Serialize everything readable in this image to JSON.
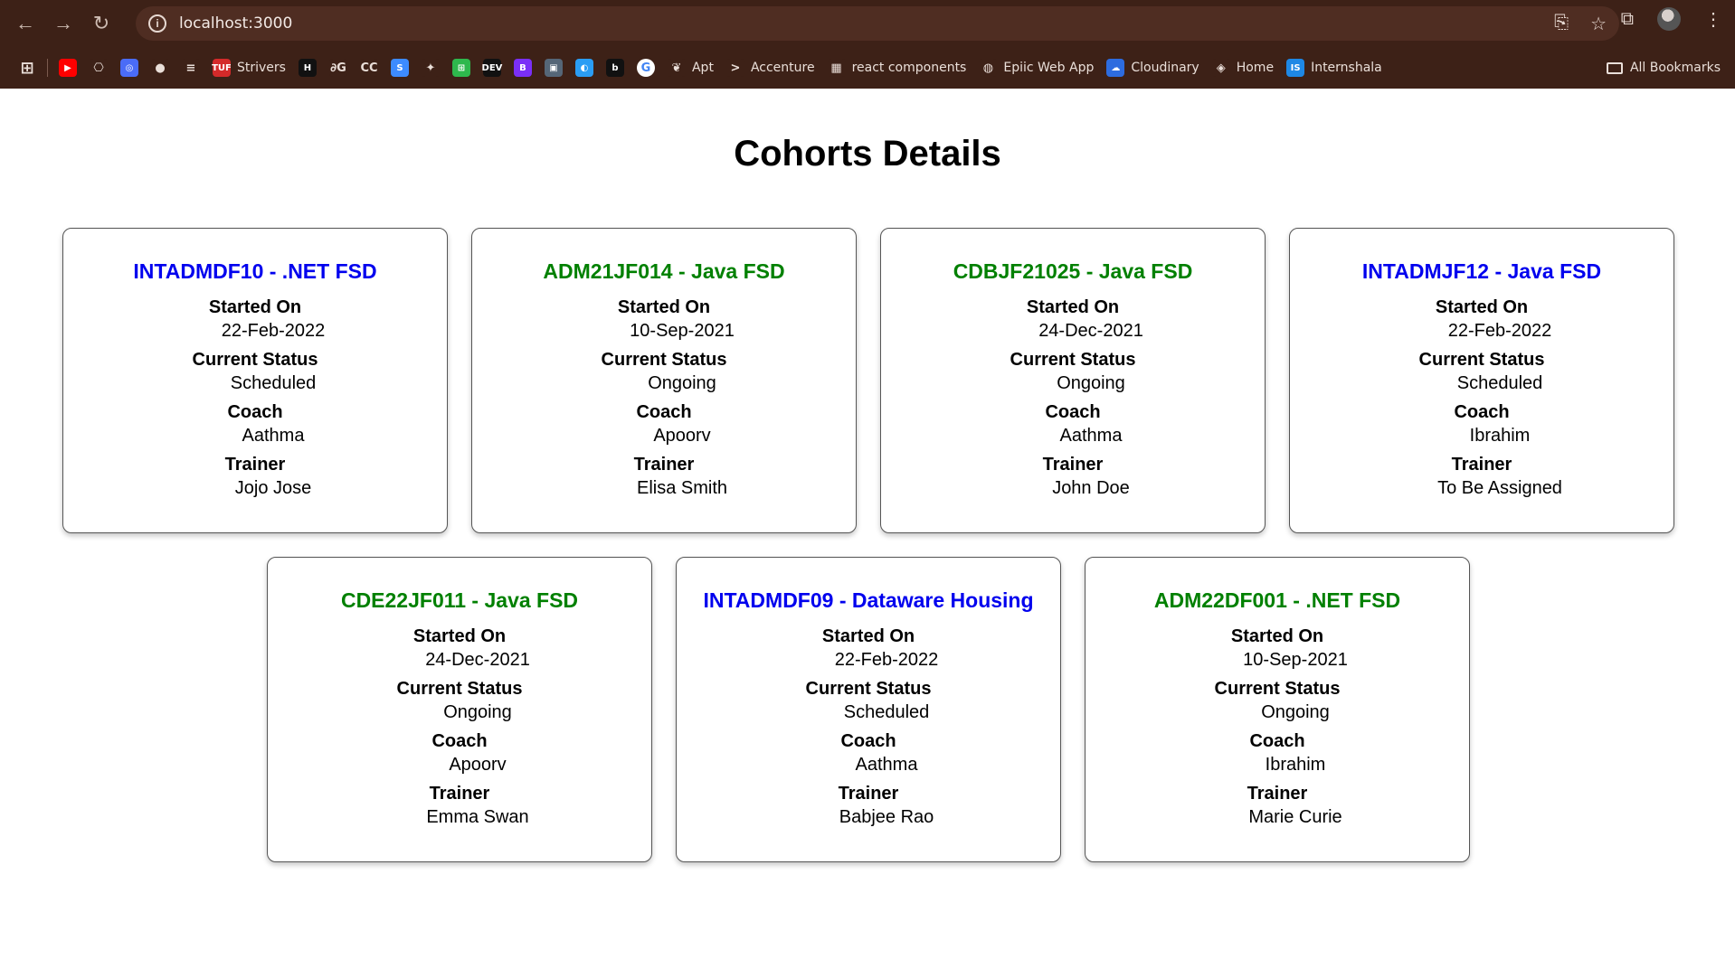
{
  "browser": {
    "url": "localhost:3000",
    "bookmarks": [
      {
        "label": "",
        "icon": "youtube-icon",
        "color": "#ff0000",
        "glyph": "▶"
      },
      {
        "label": "",
        "icon": "openai-icon",
        "color": "#3d2117",
        "glyph": "⎔"
      },
      {
        "label": "",
        "icon": "codeium-icon",
        "color": "#4a6cf7",
        "glyph": "◎"
      },
      {
        "label": "",
        "icon": "github-icon",
        "color": "#3d2117",
        "glyph": "●"
      },
      {
        "label": "",
        "icon": "stackoverflow-icon",
        "color": "#3d2117",
        "glyph": "≡"
      },
      {
        "label": "Strivers",
        "icon": "tuf-icon",
        "color": "#d42a2a",
        "glyph": "TUF"
      },
      {
        "label": "",
        "icon": "hackerrank-icon",
        "color": "#111111",
        "glyph": "H"
      },
      {
        "label": "",
        "icon": "geeksforgeeks-icon",
        "color": "#3d2117",
        "glyph": "∂G"
      },
      {
        "label": "",
        "icon": "codechef-icon",
        "color": "#3d2117",
        "glyph": "CC"
      },
      {
        "label": "",
        "icon": "swiggy-icon",
        "color": "#3d8bff",
        "glyph": "S"
      },
      {
        "label": "",
        "icon": "figma-icon",
        "color": "#3d2117",
        "glyph": "✦"
      },
      {
        "label": "",
        "icon": "green-app-icon",
        "color": "#2eb84d",
        "glyph": "⊞"
      },
      {
        "label": "",
        "icon": "dev-icon",
        "color": "#111111",
        "glyph": "DEV"
      },
      {
        "label": "",
        "icon": "bootstrap-icon",
        "color": "#7a2ff7",
        "glyph": "B"
      },
      {
        "label": "",
        "icon": "image-icon",
        "color": "#556677",
        "glyph": "▣"
      },
      {
        "label": "",
        "icon": "edge-icon",
        "color": "#2a9df4",
        "glyph": "◐"
      },
      {
        "label": "",
        "icon": "b-black-icon",
        "color": "#111111",
        "glyph": "b"
      },
      {
        "label": "",
        "icon": "google-icon",
        "color": "#ffffff",
        "glyph": "G"
      },
      {
        "label": "Apt",
        "icon": "apt-icon",
        "color": "#3d2117",
        "glyph": "❦"
      },
      {
        "label": "Accenture",
        "icon": "accenture-icon",
        "color": "#3d2117",
        "glyph": ">"
      },
      {
        "label": "react components",
        "icon": "react-components-icon",
        "color": "#3d2117",
        "glyph": "▦"
      },
      {
        "label": "Epiic Web App",
        "icon": "epiic-icon",
        "color": "#3d2117",
        "glyph": "◍"
      },
      {
        "label": "Cloudinary",
        "icon": "cloudinary-icon",
        "color": "#2d6cdf",
        "glyph": "☁"
      },
      {
        "label": "Home",
        "icon": "home-icon",
        "color": "#3d2117",
        "glyph": "◈"
      },
      {
        "label": "Internshala",
        "icon": "internshala-icon",
        "color": "#1e88e5",
        "glyph": "IS"
      }
    ],
    "all_bookmarks_label": "All Bookmarks"
  },
  "page": {
    "title": "Cohorts Details",
    "labels": {
      "started_on": "Started On",
      "current_status": "Current Status",
      "coach": "Coach",
      "trainer": "Trainer"
    },
    "colors": {
      "scheduled": "#0000ee",
      "ongoing": "#008000"
    },
    "cohorts": [
      {
        "code": "INTADMDF10 - .NET FSD",
        "started_on": "22-Feb-2022",
        "status": "Scheduled",
        "coach": "Aathma",
        "trainer": "Jojo Jose",
        "title_color": "#0000ee"
      },
      {
        "code": "ADM21JF014 - Java FSD",
        "started_on": "10-Sep-2021",
        "status": "Ongoing",
        "coach": "Apoorv",
        "trainer": "Elisa Smith",
        "title_color": "#008000"
      },
      {
        "code": "CDBJF21025 - Java FSD",
        "started_on": "24-Dec-2021",
        "status": "Ongoing",
        "coach": "Aathma",
        "trainer": "John Doe",
        "title_color": "#008000"
      },
      {
        "code": "INTADMJF12 - Java FSD",
        "started_on": "22-Feb-2022",
        "status": "Scheduled",
        "coach": "Ibrahim",
        "trainer": "To Be Assigned",
        "title_color": "#0000ee"
      },
      {
        "code": "CDE22JF011 - Java FSD",
        "started_on": "24-Dec-2021",
        "status": "Ongoing",
        "coach": "Apoorv",
        "trainer": "Emma Swan",
        "title_color": "#008000"
      },
      {
        "code": "INTADMDF09 - Dataware Housing",
        "started_on": "22-Feb-2022",
        "status": "Scheduled",
        "coach": "Aathma",
        "trainer": "Babjee Rao",
        "title_color": "#0000ee"
      },
      {
        "code": "ADM22DF001 - .NET FSD",
        "started_on": "10-Sep-2021",
        "status": "Ongoing",
        "coach": "Ibrahim",
        "trainer": "Marie Curie",
        "title_color": "#008000"
      }
    ]
  }
}
